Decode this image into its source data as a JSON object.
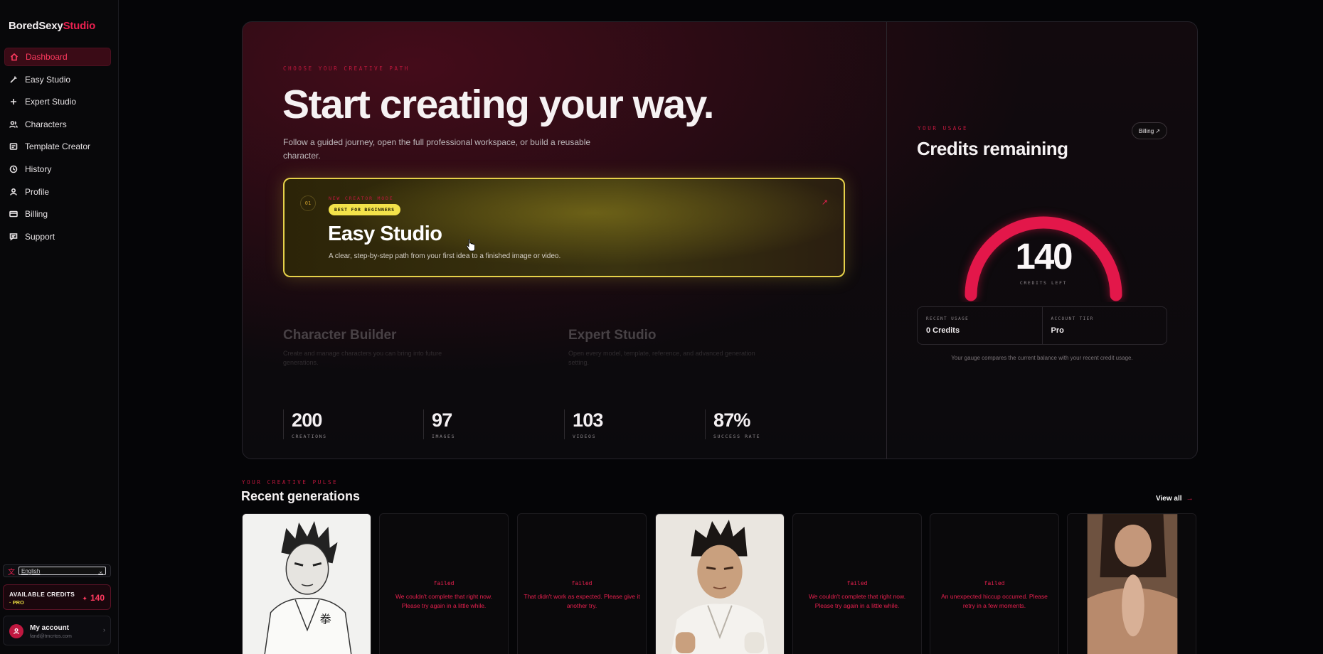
{
  "brand": {
    "name": "BoredSexy",
    "accent": "Studio"
  },
  "nav": [
    {
      "label": "Dashboard",
      "icon": "home-icon",
      "active": true
    },
    {
      "label": "Easy Studio",
      "icon": "wand-icon"
    },
    {
      "label": "Expert Studio",
      "icon": "plus-icon"
    },
    {
      "label": "Characters",
      "icon": "users-icon"
    },
    {
      "label": "Template Creator",
      "icon": "template-icon"
    },
    {
      "label": "History",
      "icon": "clock-icon"
    },
    {
      "label": "Profile",
      "icon": "user-icon"
    },
    {
      "label": "Billing",
      "icon": "card-icon"
    },
    {
      "label": "Support",
      "icon": "chat-icon"
    }
  ],
  "language": {
    "selected": "English"
  },
  "sidebar_credits": {
    "label": "AVAILABLE CREDITS",
    "tier": "· PRO",
    "value": "140"
  },
  "account": {
    "name": "My account",
    "email": "fand@tmcrtos.com"
  },
  "hero": {
    "eyebrow": "CHOOSE YOUR CREATIVE PATH",
    "title": "Start creating your way.",
    "subtitle": "Follow a guided journey, open the full professional workspace, or build a reusable character.",
    "easy": {
      "num": "01",
      "eyebrow": "NEW CREATOR MODE",
      "badge": "BEST FOR BEGINNERS",
      "title": "Easy Studio",
      "desc": "A clear, step-by-step path from your first idea to a finished image or video."
    },
    "character": {
      "title": "Character Builder",
      "desc": "Create and manage characters you can bring into future generations."
    },
    "expert": {
      "title": "Expert Studio",
      "desc": "Open every model, template, reference, and advanced generation setting."
    },
    "stats": [
      {
        "value": "200",
        "label": "CREATIONS"
      },
      {
        "value": "97",
        "label": "IMAGES"
      },
      {
        "value": "103",
        "label": "VIDEOS"
      },
      {
        "value": "87%",
        "label": "SUCCESS RATE"
      }
    ]
  },
  "usage": {
    "eyebrow": "YOUR USAGE",
    "title": "Credits remaining",
    "billing_label": "Billing ↗",
    "gauge_value": "140",
    "gauge_label": "CREDITS LEFT",
    "recent_label": "RECENT USAGE",
    "recent_value": "0 Credits",
    "tier_label": "ACCOUNT TIER",
    "tier_value": "Pro",
    "note": "Your gauge compares the current balance with your recent credit usage."
  },
  "recent": {
    "eyebrow": "YOUR CREATIVE PULSE",
    "title": "Recent generations",
    "view_all": "View all",
    "items": [
      {
        "type": "image",
        "thumb": "manga-fighter-sketch"
      },
      {
        "type": "failed",
        "status": "failed",
        "message": "We couldn't complete that right now. Please try again in a little while."
      },
      {
        "type": "failed",
        "status": "failed",
        "message": "That didn't work as expected. Please give it another try."
      },
      {
        "type": "image",
        "thumb": "martial-artist-photo"
      },
      {
        "type": "failed",
        "status": "failed",
        "message": "We couldn't complete that right now. Please try again in a little while."
      },
      {
        "type": "failed",
        "status": "failed",
        "message": "An unexpected hiccup occurred. Please retry in a few moments."
      },
      {
        "type": "image",
        "thumb": "portrait-photo"
      }
    ]
  },
  "colors": {
    "accent": "#e8204f",
    "highlight": "#e6d14a",
    "background": "#050507"
  }
}
